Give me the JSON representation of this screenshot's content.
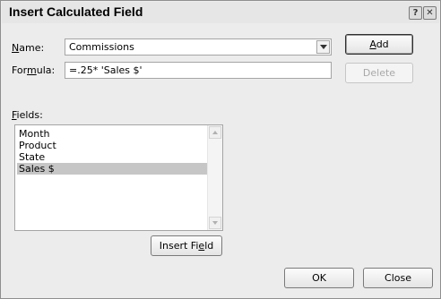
{
  "dialog": {
    "title": "Insert Calculated Field",
    "help_glyph": "?",
    "close_glyph": "✕"
  },
  "name": {
    "label_pre": "",
    "label_mnemonic": "N",
    "label_post": "ame:",
    "value": "Commissions"
  },
  "formula": {
    "label_pre": "For",
    "label_mnemonic": "m",
    "label_post": "ula:",
    "value": "=.25* 'Sales $'"
  },
  "buttons": {
    "add_pre": "",
    "add_mnemonic": "A",
    "add_post": "dd",
    "delete": "Delete",
    "insert_pre": "Insert Fi",
    "insert_mnemonic": "e",
    "insert_post": "ld",
    "ok": "OK",
    "close": "Close"
  },
  "fields": {
    "label_pre": "",
    "label_mnemonic": "F",
    "label_post": "ields:",
    "items": [
      "Month",
      "Product",
      "State",
      "Sales $"
    ],
    "selected_index": 3
  }
}
